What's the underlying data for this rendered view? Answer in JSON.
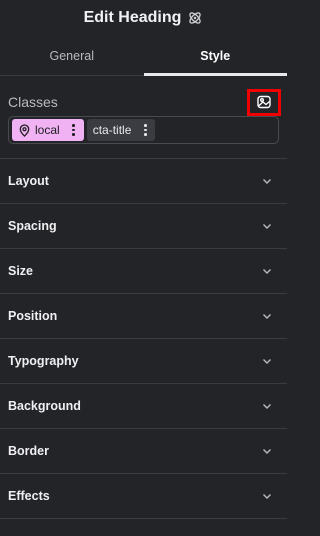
{
  "header": {
    "title": "Edit Heading",
    "icon": "elementor-logo-icon"
  },
  "tabs": [
    {
      "label": "General",
      "active": false
    },
    {
      "label": "Style",
      "active": true
    }
  ],
  "classes": {
    "title": "Classes",
    "manager_button_icon": "class-manager-icon",
    "chips": [
      {
        "label": "local",
        "type": "local",
        "icon": "location-pin-icon"
      },
      {
        "label": "cta-title",
        "type": "normal"
      }
    ]
  },
  "sections": [
    {
      "label": "Layout"
    },
    {
      "label": "Spacing"
    },
    {
      "label": "Size"
    },
    {
      "label": "Position"
    },
    {
      "label": "Typography"
    },
    {
      "label": "Background"
    },
    {
      "label": "Border"
    },
    {
      "label": "Effects"
    }
  ],
  "colors": {
    "background": "#232428",
    "divider": "#3a3b40",
    "local_chip": "#f0b2f2",
    "highlight_box": "#f00000"
  }
}
